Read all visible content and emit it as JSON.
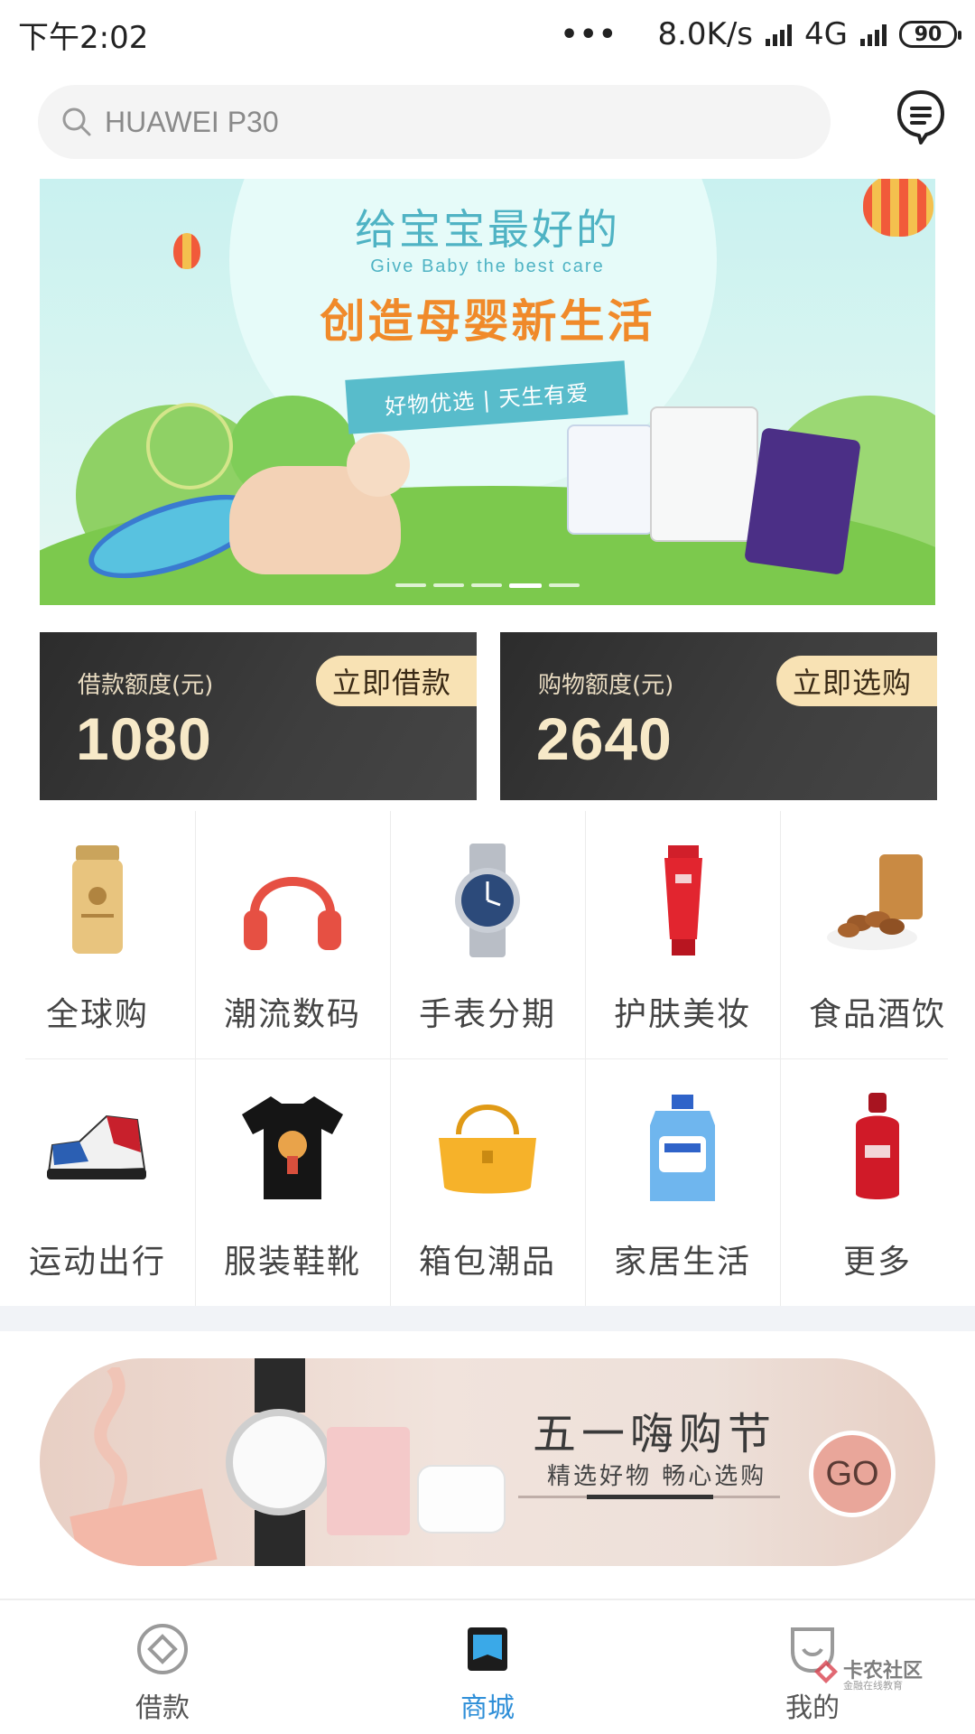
{
  "status_bar": {
    "time": "下午2:02",
    "dots": "•••",
    "speed": "8.0K/s",
    "network": "4G",
    "battery": "90"
  },
  "search": {
    "placeholder": "HUAWEI P30"
  },
  "banner": {
    "title": "给宝宝最好的",
    "subtitle_en": "Give Baby the best care",
    "headline": "创造母婴新生活",
    "ribbon_text": "好物优选 | 天生有爱",
    "slide_count": 5,
    "active_slide": 4
  },
  "credit_cards": [
    {
      "label": "借款额度(元)",
      "value": "1080",
      "action": "立即借款"
    },
    {
      "label": "购物额度(元)",
      "value": "2640",
      "action": "立即选购"
    }
  ],
  "categories": [
    {
      "label": "全球购",
      "icon": "sunscreen-bottle-icon"
    },
    {
      "label": "潮流数码",
      "icon": "headphones-icon"
    },
    {
      "label": "手表分期",
      "icon": "wristwatch-icon"
    },
    {
      "label": "护肤美妆",
      "icon": "cosmetic-tube-icon"
    },
    {
      "label": "食品酒饮",
      "icon": "nuts-bowl-icon"
    },
    {
      "label": "运动出行",
      "icon": "sneaker-icon"
    },
    {
      "label": "服装鞋靴",
      "icon": "tshirt-icon"
    },
    {
      "label": "箱包潮品",
      "icon": "handbag-icon"
    },
    {
      "label": "家居生活",
      "icon": "detergent-bottle-icon"
    },
    {
      "label": "更多",
      "icon": "serum-bottle-icon"
    }
  ],
  "promo": {
    "title": "五一嗨购节",
    "subtitle": "精选好物 畅心选购",
    "go_label": "GO"
  },
  "tab_bar": {
    "tabs": [
      {
        "label": "借款",
        "icon": "loan-icon",
        "active": false
      },
      {
        "label": "商城",
        "icon": "mall-icon",
        "active": true
      },
      {
        "label": "我的",
        "icon": "profile-icon",
        "active": false
      }
    ]
  },
  "watermark": {
    "text": "卡农社区",
    "sub": "金融在线教育"
  },
  "colors": {
    "accent": "#2f8fd8",
    "card_gold": "#f8e2b4",
    "banner_orange": "#f08a2a"
  }
}
